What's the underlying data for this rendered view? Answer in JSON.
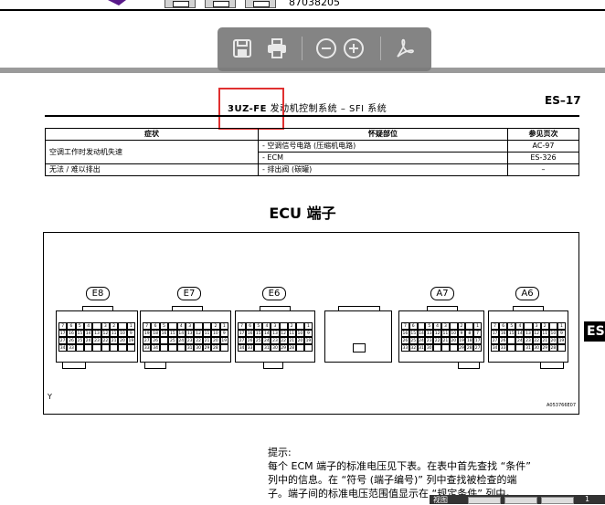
{
  "top": {
    "doc_number": "87038205"
  },
  "viewer_toolbar": {
    "save_icon": "save-icon",
    "print_icon": "print-icon",
    "zoom_out_icon": "zoom-out-icon",
    "zoom_in_icon": "zoom-in-icon",
    "acrobat_icon": "acrobat-icon"
  },
  "header": {
    "model": "3UZ-FE",
    "title": "发动机控制系统 – SFI 系统",
    "page": "ES–17"
  },
  "table": {
    "headers": [
      "症状",
      "怀疑部位",
      "参见页次"
    ],
    "rows": [
      {
        "symptom": "空调工作时发动机失速",
        "part": "- 空调信号电路 (压缩机电路)",
        "page": "AC-97"
      },
      {
        "symptom": "",
        "part": "- ECM",
        "page": "ES-326"
      },
      {
        "symptom": "无法 / 难以排出",
        "part": "- 排出阀 (碳罐)",
        "page": "–"
      }
    ]
  },
  "ecu": {
    "title": "ECU 端子",
    "connectors": [
      "E8",
      "E7",
      "E6",
      "A7",
      "A6"
    ],
    "y_label": "Y",
    "figure_id": "A053766E07"
  },
  "side_tab": "ES",
  "tip": {
    "label": "提示:",
    "lines": [
      "每个 ECM 端子的标准电压见下表。在表中首先查找 “条件”",
      "列中的信息。在 “符号 (端子编号)” 列中查找被检查的端",
      "子。端子间的标准电压范围值显示在 “规定条件” 列中。"
    ]
  },
  "bottom": {
    "view_label": "视图",
    "page_num": "1"
  }
}
